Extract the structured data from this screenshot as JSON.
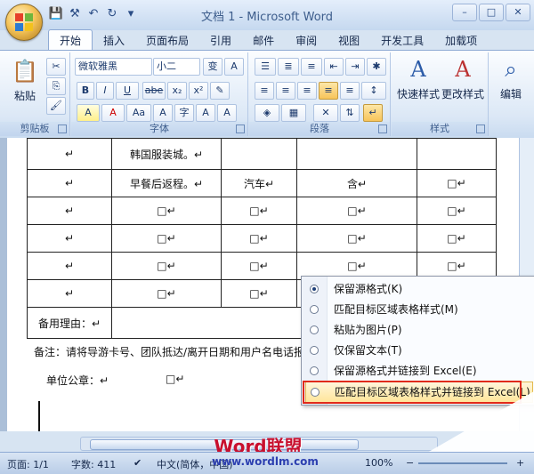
{
  "window": {
    "title": "文档 1 - Microsoft Word",
    "controls": [
      "–",
      "□",
      "✕"
    ]
  },
  "tabs": [
    "开始",
    "插入",
    "页面布局",
    "引用",
    "邮件",
    "审阅",
    "视图",
    "开发工具",
    "加载项"
  ],
  "ribbon": {
    "clipboard": {
      "label": "剪贴板",
      "paste": "粘贴"
    },
    "font": {
      "label": "字体",
      "name": "微软雅黑",
      "size": "小二",
      "buttons": [
        "B",
        "I",
        "U",
        "abe",
        "x₂",
        "x²",
        "A",
        "A",
        "Aa",
        "A",
        "A",
        "字",
        "A"
      ]
    },
    "paragraph": {
      "label": "段落"
    },
    "styles": {
      "label": "样式",
      "quick": "快速样式",
      "change": "更改样式"
    },
    "editing": {
      "label": "编辑"
    }
  },
  "document": {
    "rows": [
      {
        "c1": "↵",
        "c2": "韩国服装城。↵",
        "c3": "",
        "c4": "",
        "c5": ""
      },
      {
        "c1": "↵",
        "c2": "早餐后返程。↵",
        "c3": "汽车↵",
        "c4": "含↵",
        "c5": "□↵"
      },
      {
        "c1": "↵",
        "c2": "□↵",
        "c3": "□↵",
        "c4": "□↵",
        "c5": "□↵"
      },
      {
        "c1": "↵",
        "c2": "□↵",
        "c3": "□↵",
        "c4": "□↵",
        "c5": "□↵"
      },
      {
        "c1": "↵",
        "c2": "□↵",
        "c3": "□↵",
        "c4": "□↵",
        "c5": "□↵"
      },
      {
        "c1": "↵",
        "c2": "□↵",
        "c3": "□↵",
        "c4": "□↵",
        "c5": "□↵"
      }
    ],
    "reason_label": "备用理由：↵",
    "note": "备注：请将导游卡号、团队抵达/离开日期和用户名电话报出",
    "unit_stamp": "单位公章：↵",
    "unit_box": "□↵"
  },
  "paste_menu": {
    "items": [
      {
        "label": "保留源格式(K)",
        "selected": true
      },
      {
        "label": "匹配目标区域表格样式(M)",
        "selected": false
      },
      {
        "label": "粘贴为图片(P)",
        "selected": false
      },
      {
        "label": "仅保留文本(T)",
        "selected": false
      },
      {
        "label": "保留源格式并链接到 Excel(E)",
        "selected": false
      },
      {
        "label": "匹配目标区域表格样式并链接到 Excel(L)",
        "selected": false
      }
    ]
  },
  "statusbar": {
    "page": "页面: 1/1",
    "words": "字数: 411",
    "lang": "中文(简体，中国)",
    "zoom": "100%"
  },
  "watermark": {
    "brand": "Word联盟",
    "url": "www.wordlm.com"
  }
}
